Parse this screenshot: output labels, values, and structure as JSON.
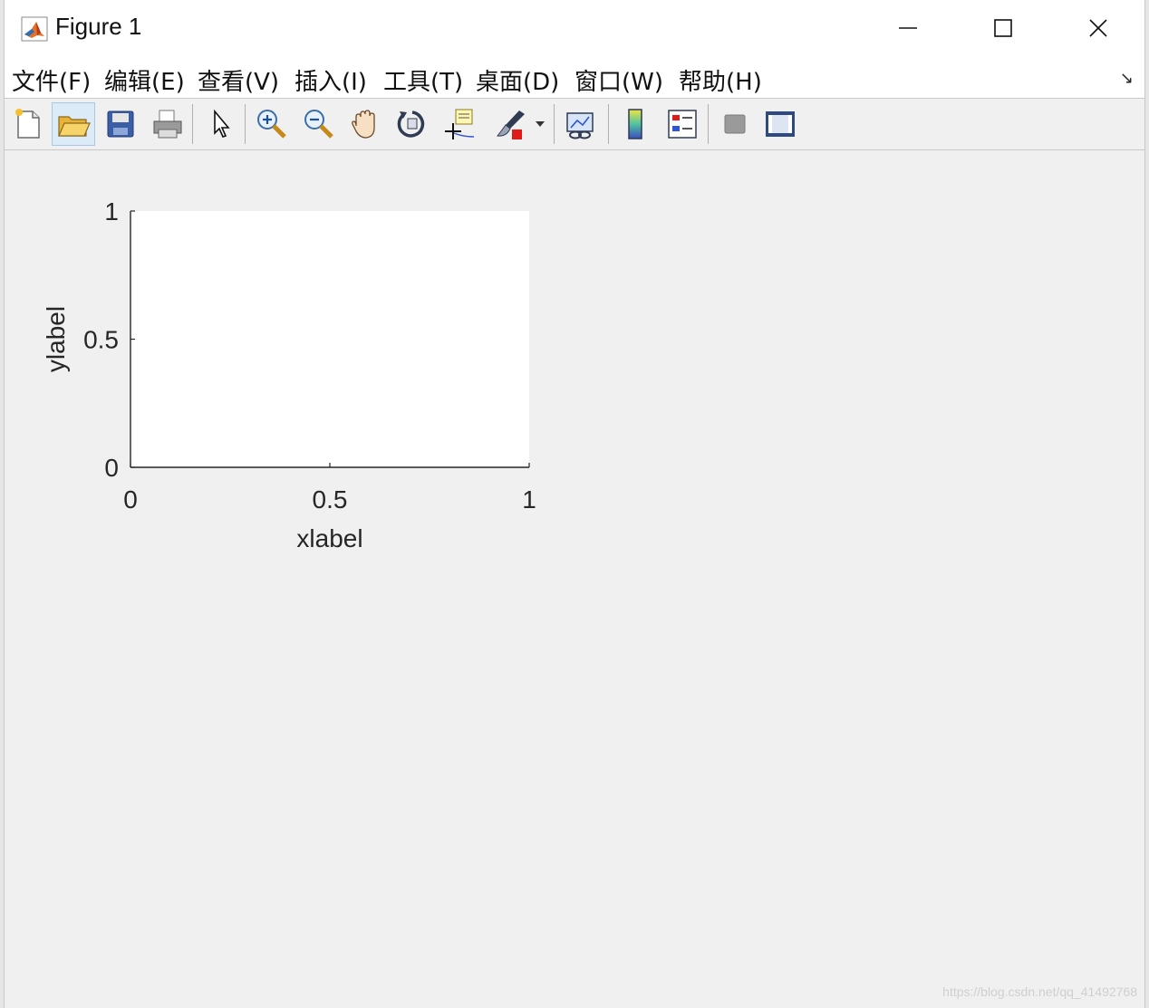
{
  "window": {
    "title": "Figure 1",
    "controls": {
      "minimize": "minimize",
      "maximize": "maximize",
      "close": "close"
    }
  },
  "menubar": {
    "items": [
      "文件(F)",
      "编辑(E)",
      "查看(V)",
      "插入(I)",
      "工具(T)",
      "桌面(D)",
      "窗口(W)",
      "帮助(H)"
    ]
  },
  "toolbar": {
    "buttons": [
      {
        "icon": "new-figure-icon"
      },
      {
        "icon": "open-file-icon",
        "state": "highlighted"
      },
      {
        "icon": "save-icon"
      },
      {
        "icon": "print-icon"
      },
      {
        "icon": "edit-plot-arrow-icon"
      },
      {
        "icon": "zoom-in-icon"
      },
      {
        "icon": "zoom-out-icon"
      },
      {
        "icon": "pan-hand-icon"
      },
      {
        "icon": "rotate-3d-icon"
      },
      {
        "icon": "data-cursor-icon"
      },
      {
        "icon": "brush-icon"
      },
      {
        "icon": "link-plot-icon"
      },
      {
        "icon": "colorbar-icon"
      },
      {
        "icon": "legend-icon"
      },
      {
        "icon": "hide-plot-tools-icon"
      },
      {
        "icon": "show-plot-tools-icon"
      }
    ]
  },
  "chart_data": {
    "type": "line",
    "x": [],
    "series": [],
    "xlabel": "xlabel",
    "ylabel": "ylabel",
    "xlim": [
      0,
      1
    ],
    "ylim": [
      0,
      1
    ],
    "xticks": [
      "0",
      "0.5",
      "1"
    ],
    "yticks": [
      "0",
      "0.5",
      "1"
    ],
    "grid": false
  },
  "watermark": "https://blog.csdn.net/qq_41492768"
}
